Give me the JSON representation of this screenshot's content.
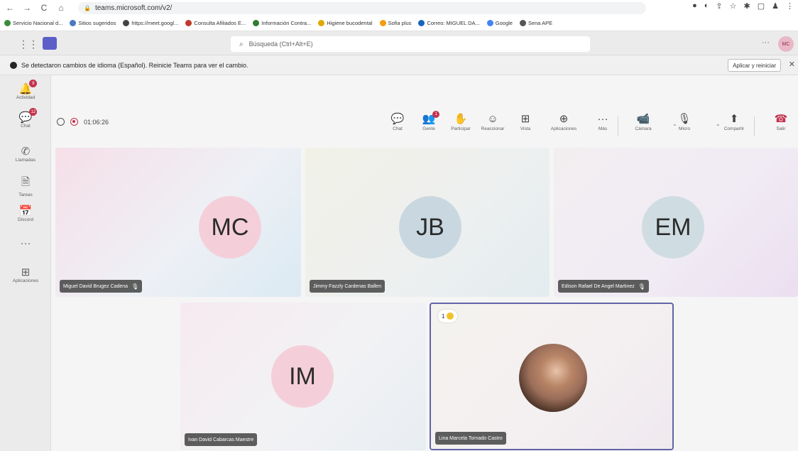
{
  "browser": {
    "url": "teams.microsoft.com/v2/",
    "bookmarks": [
      {
        "label": "Servicio Nacional d...",
        "color": "#3a8c3a"
      },
      {
        "label": "Sitios sugeridos",
        "color": "#4a78c2"
      },
      {
        "label": "https://meet.googl...",
        "color": "#444444"
      },
      {
        "label": "Consulta Afiliados E...",
        "color": "#c0392b"
      },
      {
        "label": "Información Contra...",
        "color": "#2e7d32"
      },
      {
        "label": "Higiene bucodental",
        "color": "#e0a800"
      },
      {
        "label": "Sofia plus",
        "color": "#f39c12"
      },
      {
        "label": "Correo: MIGUEL DA...",
        "color": "#1565c0"
      },
      {
        "label": "Google",
        "color": "#4285f4"
      },
      {
        "label": "Sena APE",
        "color": "#555555"
      }
    ]
  },
  "teams_header": {
    "search_placeholder": "Búsqueda (Ctrl+Alt+E)",
    "user_initials": "MC",
    "more_label": "···"
  },
  "banner": {
    "message": "Se detectaron cambios de idioma (Español). Reinicie Teams para ver el cambio.",
    "action_label": "Aplicar y reiniciar",
    "close_label": "✕"
  },
  "rail": {
    "items": [
      {
        "label": "Actividad",
        "icon": "bell-icon",
        "badge": "9"
      },
      {
        "label": "Chat",
        "icon": "chat-icon",
        "badge": "12"
      },
      {
        "label": "Llamadas",
        "icon": "phone-icon",
        "badge": ""
      },
      {
        "label": "Tareas",
        "icon": "tasks-icon",
        "badge": ""
      },
      {
        "label": "Discord",
        "icon": "calendar-icon",
        "badge": ""
      },
      {
        "label": "···",
        "icon": "more-icon",
        "badge": ""
      },
      {
        "label": "Aplicaciones",
        "icon": "apps-icon",
        "badge": ""
      }
    ]
  },
  "meeting": {
    "timer": "01:06:26",
    "toolbar": [
      {
        "label": "Chat",
        "icon": "chat-icon",
        "badge": ""
      },
      {
        "label": "Gente",
        "icon": "people-icon",
        "badge": "1"
      },
      {
        "label": "Participar",
        "icon": "raise-hand-icon",
        "badge": ""
      },
      {
        "label": "Reaccionar",
        "icon": "emoji-icon",
        "badge": ""
      },
      {
        "label": "Vista",
        "icon": "view-icon",
        "badge": ""
      },
      {
        "label": "Aplicaciones",
        "icon": "apps-icon",
        "badge": ""
      },
      {
        "label": "Más",
        "icon": "more-icon",
        "badge": ""
      },
      {
        "label": "Cámara",
        "icon": "camera-off-icon",
        "badge": ""
      },
      {
        "label": "Micro",
        "icon": "mic-off-icon",
        "badge": ""
      },
      {
        "label": "Compartir",
        "icon": "share-icon",
        "badge": ""
      },
      {
        "label": "Salir",
        "icon": "leave-icon",
        "badge": ""
      }
    ]
  },
  "participants": [
    {
      "initials": "MC",
      "name": "Miguel David Brugez Cadena",
      "muted": true,
      "circle_color": "#f4cfd9"
    },
    {
      "initials": "JB",
      "name": "Jimmy Fazzly Cardenas Ballen",
      "muted": false,
      "circle_color": "#c9d8e0"
    },
    {
      "initials": "EM",
      "name": "Edison Rafael De Angel Martinez",
      "muted": true,
      "circle_color": "#cfdde3"
    },
    {
      "initials": "IM",
      "name": "Ivan David Cabarcas Maestre",
      "muted": false,
      "circle_color": "#f4cfd9"
    },
    {
      "initials": "",
      "name": "Lina Marcela Tornado Castro",
      "muted": false,
      "circle_color": "#9b6e5a",
      "reaction_count": "1"
    }
  ]
}
